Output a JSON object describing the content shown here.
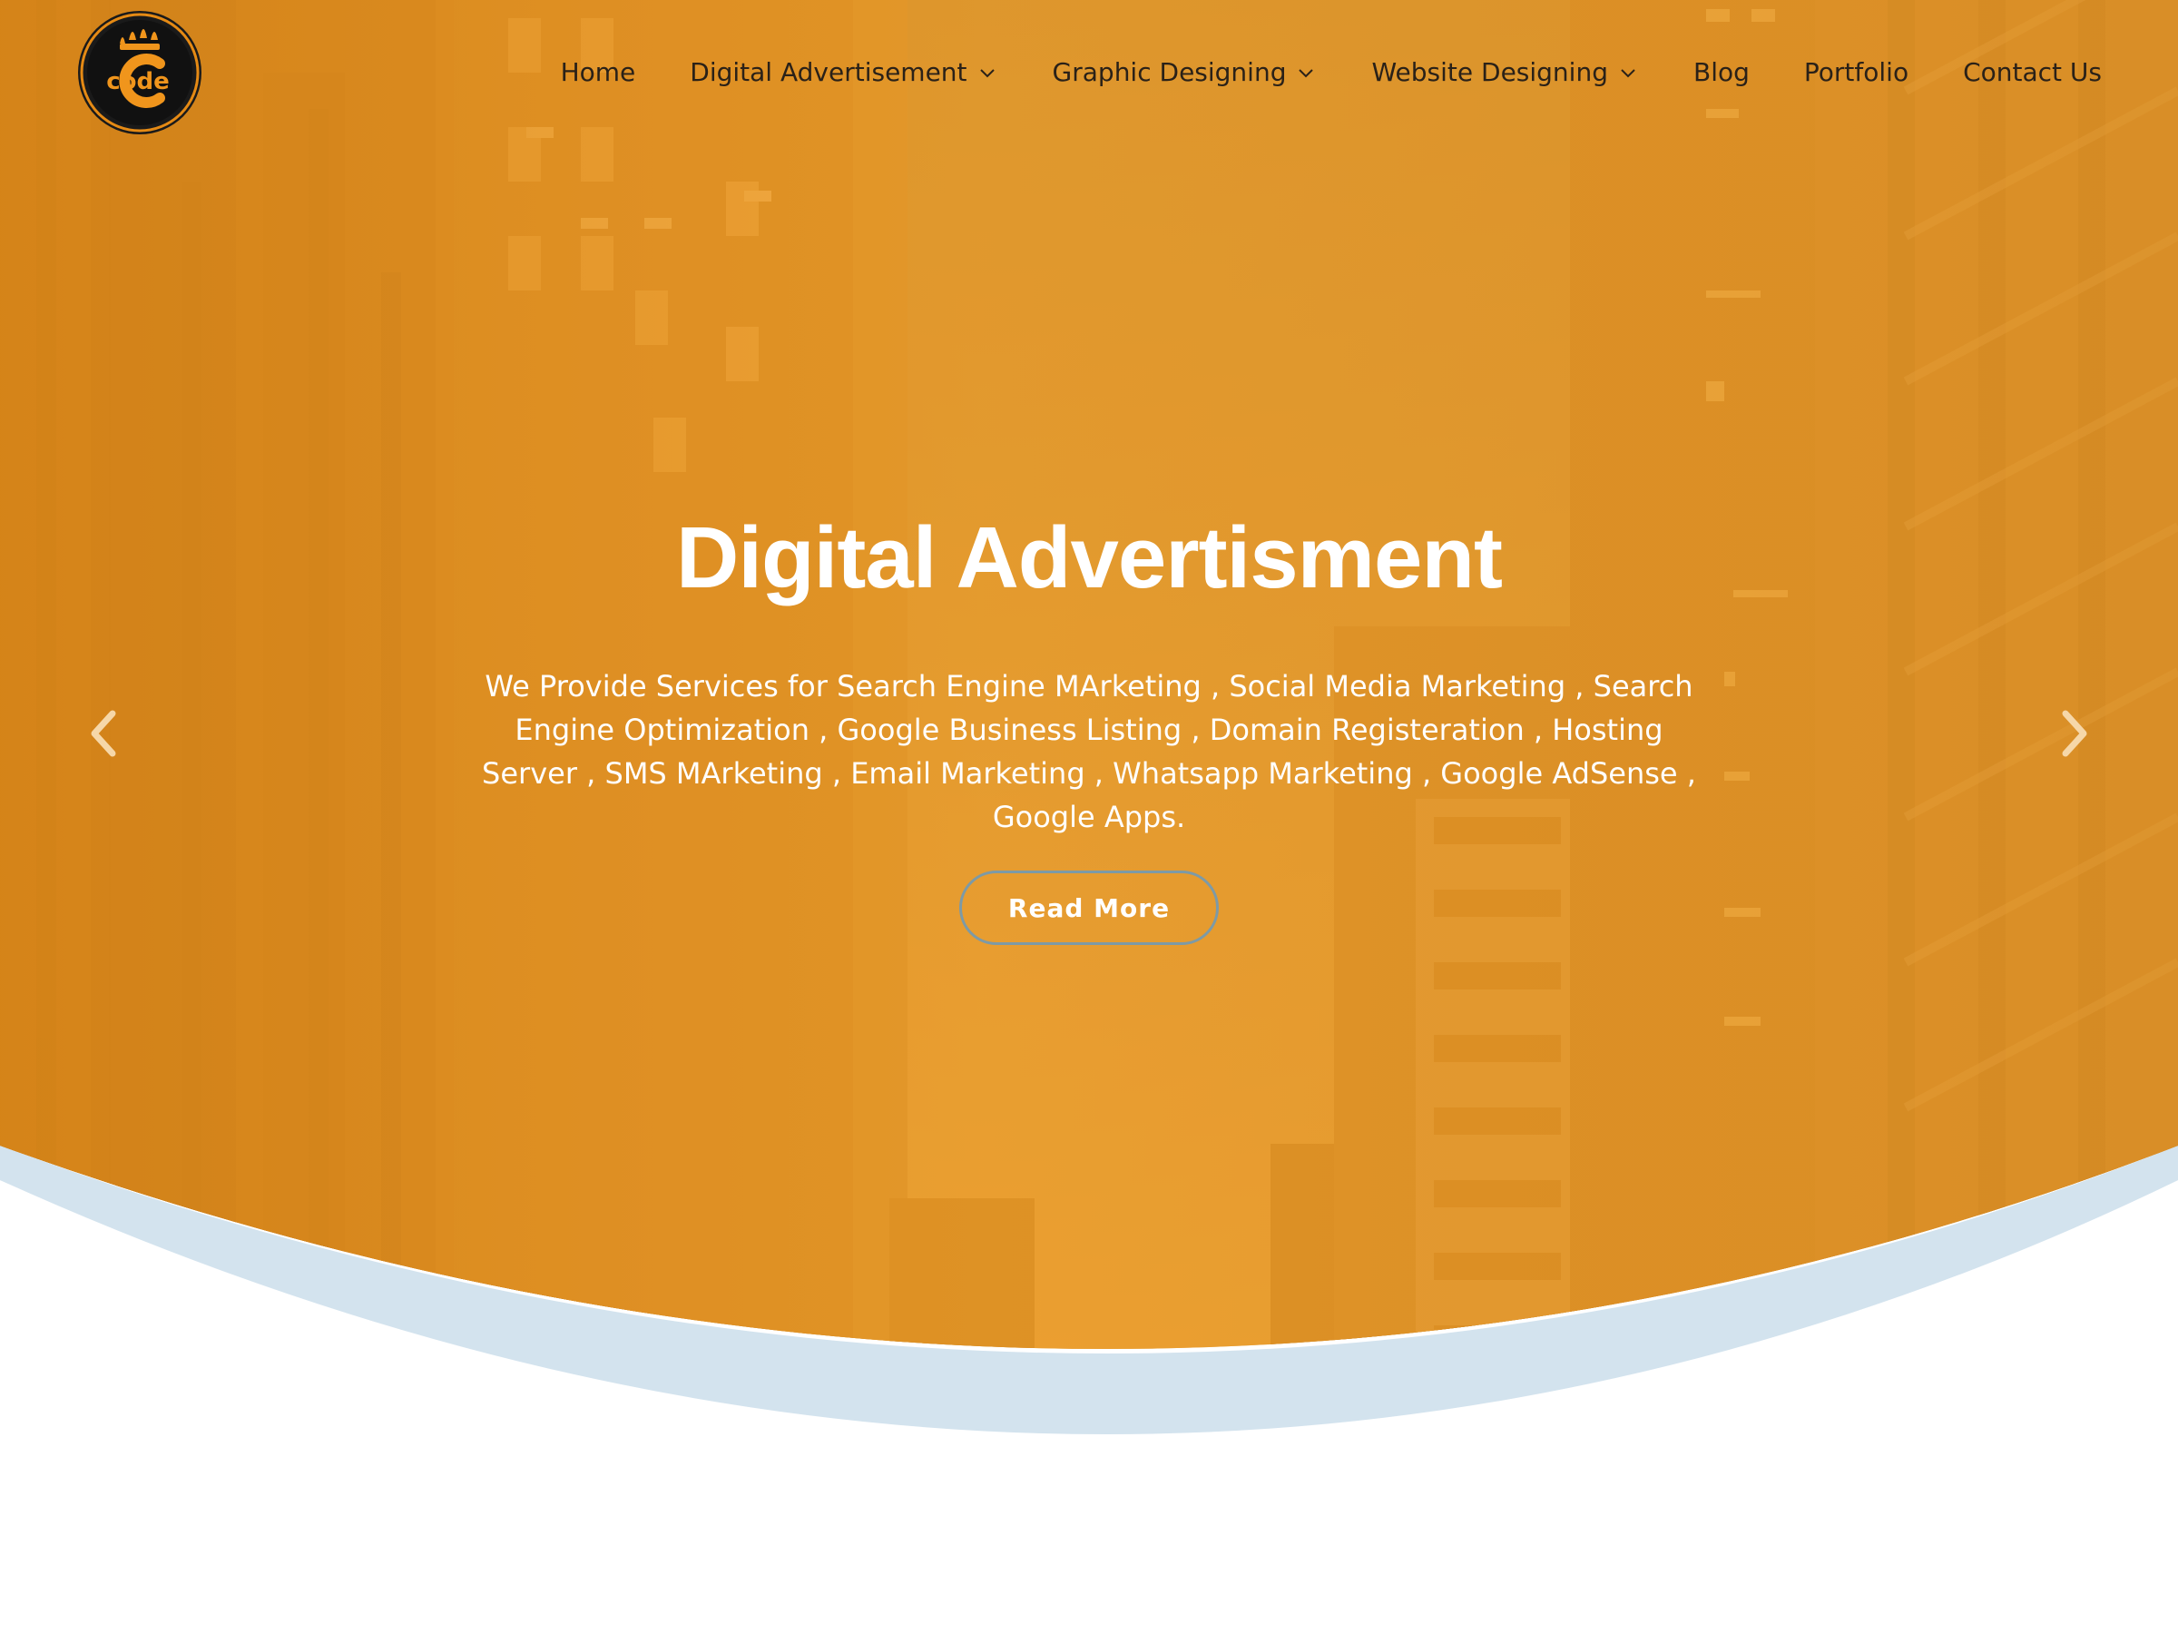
{
  "nav": {
    "items": [
      {
        "label": "Home",
        "dropdown": false
      },
      {
        "label": "Digital Advertisement",
        "dropdown": true
      },
      {
        "label": "Graphic Designing",
        "dropdown": true
      },
      {
        "label": "Website Designing",
        "dropdown": true
      },
      {
        "label": "Blog",
        "dropdown": false
      },
      {
        "label": "Portfolio",
        "dropdown": false
      },
      {
        "label": "Contact Us",
        "dropdown": false
      }
    ]
  },
  "logo": {
    "text": "code"
  },
  "hero": {
    "title": "Digital Advertisment",
    "description": "We Provide Services for Search Engine MArketing , Social Media Marketing , Search Engine Optimization , Google Business Listing , Domain Registeration , Hosting Server , SMS MArketing , Email Marketing , Whatsapp Marketing , Google AdSense , Google Apps.",
    "button_label": "Read More"
  },
  "icons": {
    "prev": "chevron-left-icon",
    "next": "chevron-right-icon",
    "dropdown": "chevron-down-icon"
  },
  "colors": {
    "overlay": "#e59a2c",
    "wave": "#d3e3ee",
    "button_border": "#7d9aa6",
    "nav_text": "#2a2118"
  }
}
